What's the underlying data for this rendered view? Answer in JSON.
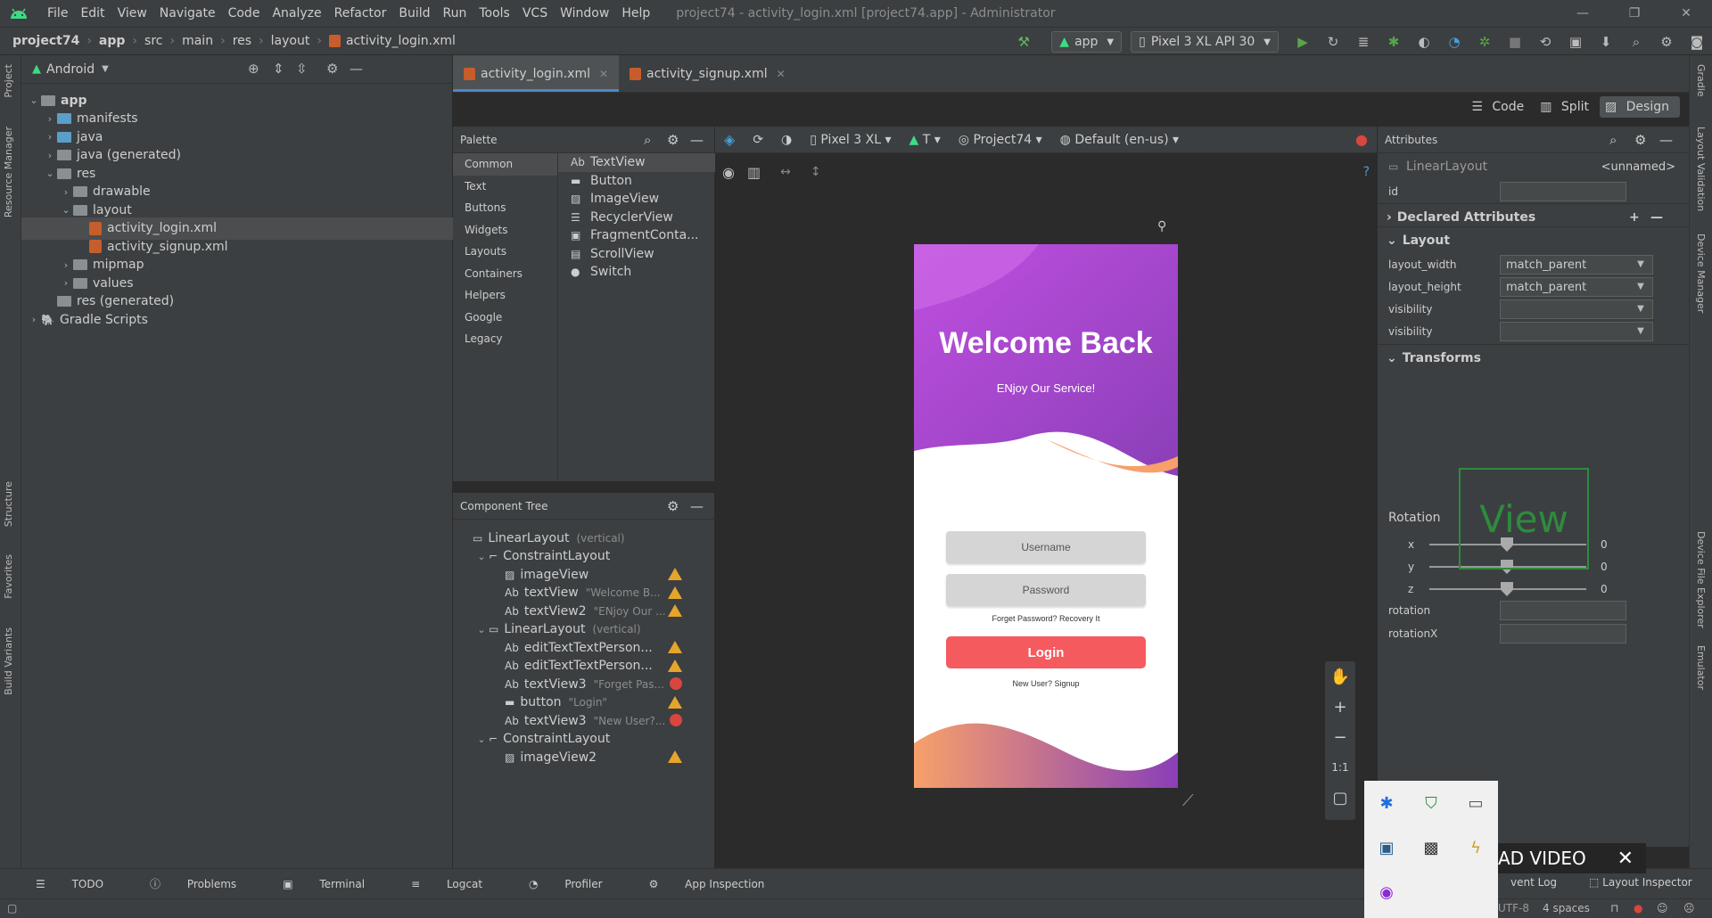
{
  "titlebar": {
    "menu": [
      "File",
      "Edit",
      "View",
      "Navigate",
      "Code",
      "Analyze",
      "Refactor",
      "Build",
      "Run",
      "Tools",
      "VCS",
      "Window",
      "Help"
    ],
    "title": "project74 - activity_login.xml [project74.app] - Administrator"
  },
  "navbar": {
    "crumbs": [
      "project74",
      "app",
      "src",
      "main",
      "res",
      "layout",
      "activity_login.xml"
    ],
    "run_config": "app",
    "device": "Pixel 3 XL API 30"
  },
  "project": {
    "view_mode": "Android",
    "tree": [
      {
        "label": "app",
        "depth": 0,
        "expanded": true,
        "kind": "module"
      },
      {
        "label": "manifests",
        "depth": 1,
        "expanded": false,
        "kind": "folder"
      },
      {
        "label": "java",
        "depth": 1,
        "expanded": false,
        "kind": "folder"
      },
      {
        "label": "java (generated)",
        "depth": 1,
        "expanded": false,
        "kind": "folder-gen"
      },
      {
        "label": "res",
        "depth": 1,
        "expanded": true,
        "kind": "folder-res"
      },
      {
        "label": "drawable",
        "depth": 2,
        "expanded": false,
        "kind": "folder-res"
      },
      {
        "label": "layout",
        "depth": 2,
        "expanded": true,
        "kind": "folder-res"
      },
      {
        "label": "activity_login.xml",
        "depth": 3,
        "kind": "xml",
        "selected": true
      },
      {
        "label": "activity_signup.xml",
        "depth": 3,
        "kind": "xml"
      },
      {
        "label": "mipmap",
        "depth": 2,
        "expanded": false,
        "kind": "folder-res"
      },
      {
        "label": "values",
        "depth": 2,
        "expanded": false,
        "kind": "folder-res"
      },
      {
        "label": "res (generated)",
        "depth": 1,
        "kind": "folder-gen"
      },
      {
        "label": "Gradle Scripts",
        "depth": 0,
        "expanded": false,
        "kind": "gradle"
      }
    ]
  },
  "left_strip": [
    "Project",
    "Resource Manager",
    "Structure",
    "Favorites",
    "Build Variants"
  ],
  "right_strip": [
    "Gradle",
    "Layout Validation",
    "Device Manager",
    "Device File Explorer",
    "Emulator"
  ],
  "editor_tabs": [
    {
      "label": "activity_login.xml",
      "active": true
    },
    {
      "label": "activity_signup.xml",
      "active": false
    }
  ],
  "view_modes": {
    "code": "Code",
    "split": "Split",
    "design": "Design",
    "active": "Design"
  },
  "palette": {
    "title": "Palette",
    "categories": [
      "Common",
      "Text",
      "Buttons",
      "Widgets",
      "Layouts",
      "Containers",
      "Helpers",
      "Google",
      "Legacy"
    ],
    "items": [
      "TextView",
      "Button",
      "ImageView",
      "RecyclerView",
      "FragmentConta...",
      "ScrollView",
      "Switch"
    ]
  },
  "design_toolbar": {
    "device": "Pixel 3 XL",
    "api": "T",
    "theme": "Project74",
    "locale": "Default (en-us)"
  },
  "component_tree": {
    "title": "Component Tree",
    "rows": [
      {
        "label": "LinearLayout",
        "hint": "(vertical)",
        "depth": 0,
        "icon": "linear-layout",
        "status": ""
      },
      {
        "label": "ConstraintLayout",
        "hint": "",
        "depth": 1,
        "icon": "constraint-layout",
        "status": ""
      },
      {
        "label": "imageView",
        "hint": "",
        "depth": 2,
        "icon": "image",
        "status": "warning"
      },
      {
        "label": "textView",
        "hint": "\"Welcome B...",
        "depth": 2,
        "icon": "text",
        "status": "warning"
      },
      {
        "label": "textView2",
        "hint": "\"ENjoy Our ...",
        "depth": 2,
        "icon": "text",
        "status": "warning"
      },
      {
        "label": "LinearLayout",
        "hint": "(vertical)",
        "depth": 1,
        "icon": "linear-layout",
        "status": ""
      },
      {
        "label": "editTextTextPerson...",
        "hint": "",
        "depth": 2,
        "icon": "edittext",
        "status": "warning"
      },
      {
        "label": "editTextTextPerson...",
        "hint": "",
        "depth": 2,
        "icon": "edittext",
        "status": "warning"
      },
      {
        "label": "textView3",
        "hint": "\"Forget Pas...",
        "depth": 2,
        "icon": "text",
        "status": "error"
      },
      {
        "label": "button",
        "hint": "\"Login\"",
        "depth": 2,
        "icon": "button",
        "status": "warning"
      },
      {
        "label": "textView3",
        "hint": "\"New User?...",
        "depth": 2,
        "icon": "text",
        "status": "error"
      },
      {
        "label": "ConstraintLayout",
        "hint": "",
        "depth": 1,
        "icon": "constraint-layout",
        "status": ""
      },
      {
        "label": "imageView2",
        "hint": "",
        "depth": 2,
        "icon": "image",
        "status": "warning"
      }
    ]
  },
  "phone": {
    "welcome": "Welcome Back",
    "subtitle": "ENjoy Our Service!",
    "username_hint": "Username",
    "password_hint": "Password",
    "forgot": "Forget Password? Recovery It",
    "login": "Login",
    "new_user": "New User? Signup",
    "gradient_colors": [
      "#c04fe0",
      "#8a3fb8",
      "#f7a06a"
    ],
    "button_color": "#f55a5e"
  },
  "zoom": {
    "fit_label": "1:1"
  },
  "attributes": {
    "title": "Attributes",
    "element": "LinearLayout",
    "element_name": "<unnamed>",
    "id_label": "id",
    "declared": "Declared Attributes",
    "layout": "Layout",
    "layout_rows": [
      {
        "name": "layout_width",
        "value": "match_parent"
      },
      {
        "name": "layout_height",
        "value": "match_parent"
      },
      {
        "name": "visibility",
        "value": ""
      },
      {
        "name": "visibility",
        "value": ""
      }
    ],
    "transforms": "Transforms",
    "preview": "View",
    "rotation_label": "Rotation",
    "rotation": [
      {
        "axis": "x",
        "value": "0"
      },
      {
        "axis": "y",
        "value": "0"
      },
      {
        "axis": "z",
        "value": "0"
      }
    ],
    "extra_rows": [
      "rotation",
      "rotationX"
    ]
  },
  "bottom_tabs": [
    "TODO",
    "Problems",
    "Terminal",
    "Logcat",
    "Profiler",
    "App Inspection"
  ],
  "bottom_right": {
    "event_log": "vent Log",
    "layout_inspector": "Layout Inspector"
  },
  "status": {
    "encoding": "UTF-8",
    "indent": "4 spaces"
  },
  "overlay": {
    "download_text": "AD VIDEO"
  }
}
